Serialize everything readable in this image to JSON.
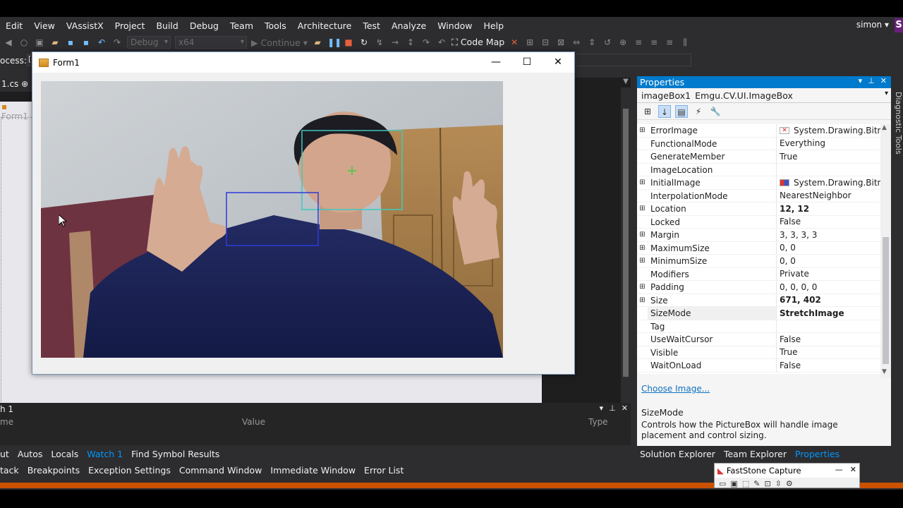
{
  "menu": {
    "items": [
      "Edit",
      "View",
      "VAssistX",
      "Project",
      "Build",
      "Debug",
      "Team",
      "Tools",
      "Architecture",
      "Test",
      "Analyze",
      "Window",
      "Help"
    ],
    "user": "simon",
    "badge": "S"
  },
  "toolbar": {
    "config": "Debug",
    "platform": "x64",
    "continue_label": "Continue",
    "code_map_label": "Code Map",
    "process_label": "ocess:",
    "process_value": "[4"
  },
  "doc_tabs": {
    "cs_tab": "1.cs",
    "form_tab": "Form1"
  },
  "form": {
    "title": "Form1",
    "minimize_glyph": "—",
    "maximize_glyph": "☐",
    "close_glyph": "✕"
  },
  "properties": {
    "panel_title": "Properties",
    "object_name": "imageBox1",
    "object_type": "Emgu.CV.UI.ImageBox",
    "rows": [
      {
        "name": "ErrorImage",
        "value": "System.Drawing.Bitm",
        "expand": "⊞",
        "bold": false,
        "icon": "error-image-icon"
      },
      {
        "name": "FunctionalMode",
        "value": "Everything",
        "expand": "",
        "bold": false
      },
      {
        "name": "GenerateMember",
        "value": "True",
        "expand": "",
        "bold": false
      },
      {
        "name": "ImageLocation",
        "value": "",
        "expand": "",
        "bold": false
      },
      {
        "name": "InitialImage",
        "value": "System.Drawing.Bitm",
        "expand": "⊞",
        "bold": false,
        "icon": "initial-image-icon"
      },
      {
        "name": "InterpolationMode",
        "value": "NearestNeighbor",
        "expand": "",
        "bold": false
      },
      {
        "name": "Location",
        "value": "12, 12",
        "expand": "⊞",
        "bold": true
      },
      {
        "name": "Locked",
        "value": "False",
        "expand": "",
        "bold": false
      },
      {
        "name": "Margin",
        "value": "3, 3, 3, 3",
        "expand": "⊞",
        "bold": false
      },
      {
        "name": "MaximumSize",
        "value": "0, 0",
        "expand": "⊞",
        "bold": false
      },
      {
        "name": "MinimumSize",
        "value": "0, 0",
        "expand": "⊞",
        "bold": false
      },
      {
        "name": "Modifiers",
        "value": "Private",
        "expand": "",
        "bold": false
      },
      {
        "name": "Padding",
        "value": "0, 0, 0, 0",
        "expand": "⊞",
        "bold": false
      },
      {
        "name": "Size",
        "value": "671, 402",
        "expand": "⊞",
        "bold": true
      },
      {
        "name": "SizeMode",
        "value": "StretchImage",
        "expand": "",
        "bold": true
      },
      {
        "name": "Tag",
        "value": "",
        "expand": "",
        "bold": false
      },
      {
        "name": "UseWaitCursor",
        "value": "False",
        "expand": "",
        "bold": false
      },
      {
        "name": "Visible",
        "value": "True",
        "expand": "",
        "bold": false
      },
      {
        "name": "WaitOnLoad",
        "value": "False",
        "expand": "",
        "bold": false
      }
    ],
    "choose_image_link": "Choose Image...",
    "desc_title": "SizeMode",
    "desc_text": "Controls how the PictureBox will handle image placement and control sizing."
  },
  "right_tabs": [
    "Solution Explorer",
    "Team Explorer",
    "Properties"
  ],
  "diagnostic_tools": "Diagnostic Tools",
  "watch": {
    "title": "h 1",
    "col_name": "me",
    "col_value": "Value",
    "col_type": "Type"
  },
  "bottom_tabs_1": [
    "ut",
    "Autos",
    "Locals",
    "Watch 1",
    "Find Symbol Results"
  ],
  "bottom_tabs_2": [
    "tack",
    "Breakpoints",
    "Exception Settings",
    "Command Window",
    "Immediate Window",
    "Error List"
  ],
  "faststone": {
    "title": "FastStone Capture"
  },
  "colors": {
    "accent": "#007acc",
    "status_bar": "#ca5100",
    "ide_bg": "#2d2d30"
  }
}
